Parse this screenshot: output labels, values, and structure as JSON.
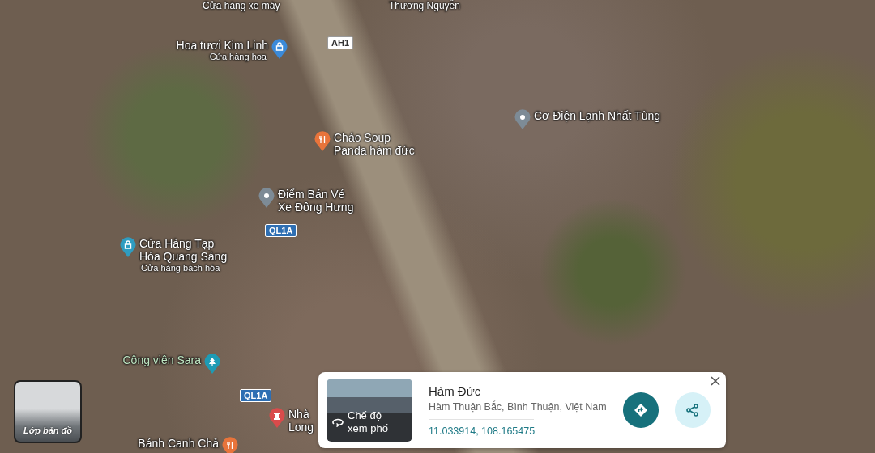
{
  "map": {
    "top_labels": [
      "Cửa hàng xe máy",
      "Thương Nguyễn"
    ],
    "places": [
      {
        "kind": "shop",
        "lines": [
          "Hoa tươi Kim Linh"
        ],
        "category": "Cửa hàng hoa",
        "color": "#3b8ad9"
      },
      {
        "kind": "food",
        "lines": [
          "Cháo Soup",
          "Panda hàm đức"
        ],
        "color": "#e8743b"
      },
      {
        "kind": "pin",
        "lines": [
          "Cơ Điện Lạnh Nhất Tùng"
        ],
        "color": "#7d8b96"
      },
      {
        "kind": "pin",
        "lines": [
          "Điểm Bán Vé",
          "Xe Đông Hưng"
        ],
        "color": "#7d8b96"
      },
      {
        "kind": "shop",
        "lines": [
          "Cửa Hàng Tạp",
          "Hóa Quang Sáng"
        ],
        "category": "Cửa hàng bách hóa",
        "color": "#2f9cc0"
      },
      {
        "kind": "park",
        "lines": [
          "Công viên Sara"
        ],
        "color": "#1e9bb5"
      },
      {
        "kind": "landmark",
        "lines": [
          "Nhà",
          "Long"
        ],
        "color": "#d94b4b"
      },
      {
        "kind": "food",
        "lines": [
          "Bánh Canh Chả"
        ],
        "color": "#e8743b"
      }
    ],
    "road_shields": [
      {
        "kind": "asian",
        "label": "AH1"
      },
      {
        "kind": "national",
        "label": "QL1A"
      },
      {
        "kind": "national",
        "label": "QL1A"
      }
    ]
  },
  "layers_button": {
    "label": "Lớp bản đồ"
  },
  "place_card": {
    "street_view": [
      "Chế độ",
      "xem phố"
    ],
    "title": "Hàm Đức",
    "address": "Hàm Thuận Bắc, Bình Thuận, Việt Nam",
    "coordinates": "11.033914, 108.165475"
  }
}
